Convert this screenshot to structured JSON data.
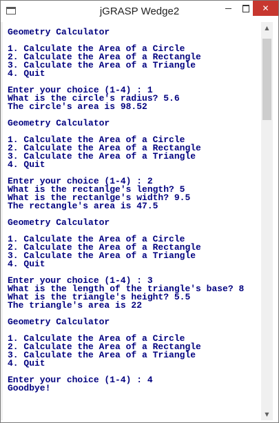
{
  "window": {
    "title": "jGRASP Wedge2",
    "minimize_glyph": "",
    "close_glyph": "✕"
  },
  "scrollbar": {
    "up_arrow": "▲",
    "down_arrow": "▼"
  },
  "console": {
    "text": "Geometry Calculator\n\n1. Calculate the Area of a Circle\n2. Calculate the Area of a Rectangle\n3. Calculate the Area of a Triangle\n4. Quit\n\nEnter your choice (1-4) : 1\nWhat is the circle's radius? 5.6\nThe circle's area is 98.52\n\nGeometry Calculator\n\n1. Calculate the Area of a Circle\n2. Calculate the Area of a Rectangle\n3. Calculate the Area of a Triangle\n4. Quit\n\nEnter your choice (1-4) : 2\nWhat is the rectanlge's length? 5\nWhat is the rectanlge's width? 9.5\nThe rectangle's area is 47.5\n\nGeometry Calculator\n\n1. Calculate the Area of a Circle\n2. Calculate the Area of a Rectangle\n3. Calculate the Area of a Triangle\n4. Quit\n\nEnter your choice (1-4) : 3\nWhat is the length of the triangle's base? 8\nWhat is the triangle's height? 5.5\nThe triangle's area is 22\n\nGeometry Calculator\n\n1. Calculate the Area of a Circle\n2. Calculate the Area of a Rectangle\n3. Calculate the Area of a Triangle\n4. Quit\n\nEnter your choice (1-4) : 4\nGoodbye!"
  }
}
